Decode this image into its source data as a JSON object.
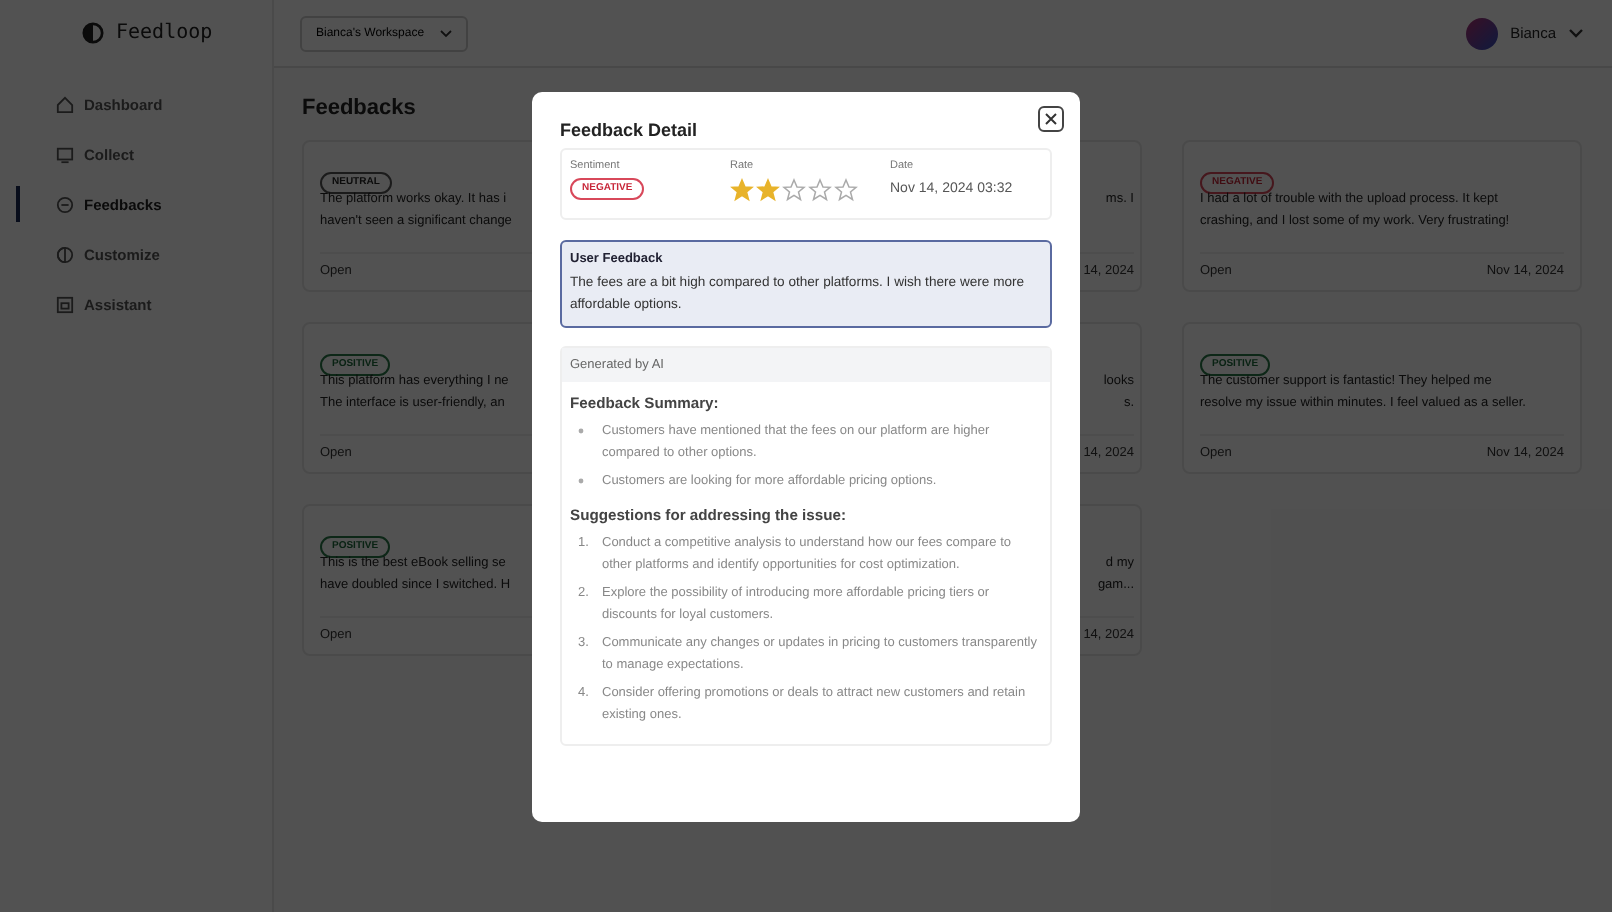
{
  "brand": {
    "name": "Feedloop"
  },
  "workspace": {
    "label": "Bianca's Workspace"
  },
  "user": {
    "name": "Bianca"
  },
  "sidebar": {
    "items": [
      {
        "label": "Dashboard",
        "selected": false
      },
      {
        "label": "Collect",
        "selected": false
      },
      {
        "label": "Feedbacks",
        "selected": true
      },
      {
        "label": "Customize",
        "selected": false
      },
      {
        "label": "Assistant",
        "selected": false
      }
    ]
  },
  "page": {
    "title": "Feedbacks"
  },
  "columns": [
    {
      "cards": [
        {
          "kind": "neutral",
          "badge": "NEUTRAL",
          "lines": [
            "The platform works okay. It has i",
            "haven't seen a significant change"
          ],
          "status": "Open"
        },
        {
          "kind": "positive",
          "badge": "POSITIVE",
          "lines": [
            "This platform has everything I ne",
            "The interface is user-friendly, an"
          ],
          "status": "Open"
        },
        {
          "kind": "positive",
          "badge": "POSITIVE",
          "lines": [
            "This is the best eBook selling se",
            "have doubled since I switched. H"
          ],
          "status": "Open"
        }
      ]
    },
    {
      "cards": [
        {
          "lines": [
            "ms. I"
          ],
          "date": "14, 2024"
        },
        {
          "lines": [
            "looks",
            "s."
          ],
          "date": "14, 2024"
        },
        {
          "lines": [
            "d my",
            "gam..."
          ],
          "date": "14, 2024"
        }
      ]
    },
    {
      "cards": [
        {
          "kind": "negative",
          "badge": "NEGATIVE",
          "lines": [
            "I had a lot of trouble with the upload process. It kept",
            "crashing, and I lost some of my work. Very frustrating!"
          ],
          "status": "Open",
          "date": "Nov 14, 2024"
        },
        {
          "kind": "positive",
          "badge": "POSITIVE",
          "lines": [
            "The customer support is fantastic! They helped me",
            "resolve my issue within minutes. I feel valued as a seller."
          ],
          "status": "Open",
          "date": "Nov 14, 2024"
        }
      ]
    }
  ],
  "modal": {
    "title": "Feedback Detail",
    "sentiment": {
      "label": "Sentiment",
      "kind": "negative",
      "badge": "NEGATIVE"
    },
    "rate": {
      "label": "Rate",
      "stars": 2
    },
    "date": {
      "label": "Date",
      "value": "Nov 14, 2024 03:32"
    },
    "user_feedback": {
      "title": "User Feedback",
      "text": "The fees are a bit high compared to other platforms. I wish there were more affordable options."
    },
    "ai": {
      "header": "Generated by AI",
      "summary_title": "Feedback Summary:",
      "summary": [
        "Customers have mentioned that the fees on our platform are higher compared to other options.",
        "Customers are looking for more affordable pricing options."
      ],
      "suggestions_title": "Suggestions for addressing the issue:",
      "suggestions": [
        {
          "number": "1.",
          "text": "Conduct a competitive analysis to understand how our fees compare to other platforms and identify opportunities for cost optimization."
        },
        {
          "number": "2.",
          "text": "Explore the possibility of introducing more affordable pricing tiers or discounts for loyal customers."
        },
        {
          "number": "3.",
          "text": "Communicate any changes or updates in pricing to customers transparently to manage expectations."
        },
        {
          "number": "4.",
          "text": "Consider offering promotions or deals to attract new customers and retain existing ones."
        }
      ]
    }
  }
}
